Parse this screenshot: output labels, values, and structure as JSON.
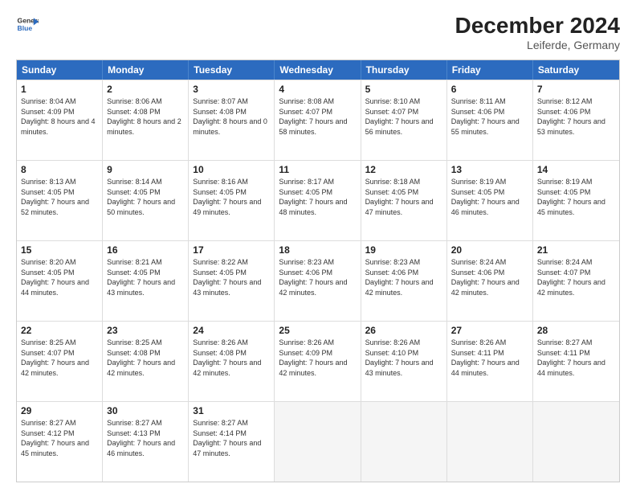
{
  "logo": {
    "line1": "General",
    "line2": "Blue",
    "arrow_color": "#2c6bbf"
  },
  "title": "December 2024",
  "subtitle": "Leiferde, Germany",
  "days_of_week": [
    "Sunday",
    "Monday",
    "Tuesday",
    "Wednesday",
    "Thursday",
    "Friday",
    "Saturday"
  ],
  "weeks": [
    [
      {
        "day": 1,
        "sunrise": "8:04 AM",
        "sunset": "4:09 PM",
        "daylight": "8 hours and 4 minutes."
      },
      {
        "day": 2,
        "sunrise": "8:06 AM",
        "sunset": "4:08 PM",
        "daylight": "8 hours and 2 minutes."
      },
      {
        "day": 3,
        "sunrise": "8:07 AM",
        "sunset": "4:08 PM",
        "daylight": "8 hours and 0 minutes."
      },
      {
        "day": 4,
        "sunrise": "8:08 AM",
        "sunset": "4:07 PM",
        "daylight": "7 hours and 58 minutes."
      },
      {
        "day": 5,
        "sunrise": "8:10 AM",
        "sunset": "4:07 PM",
        "daylight": "7 hours and 56 minutes."
      },
      {
        "day": 6,
        "sunrise": "8:11 AM",
        "sunset": "4:06 PM",
        "daylight": "7 hours and 55 minutes."
      },
      {
        "day": 7,
        "sunrise": "8:12 AM",
        "sunset": "4:06 PM",
        "daylight": "7 hours and 53 minutes."
      }
    ],
    [
      {
        "day": 8,
        "sunrise": "8:13 AM",
        "sunset": "4:05 PM",
        "daylight": "7 hours and 52 minutes."
      },
      {
        "day": 9,
        "sunrise": "8:14 AM",
        "sunset": "4:05 PM",
        "daylight": "7 hours and 50 minutes."
      },
      {
        "day": 10,
        "sunrise": "8:16 AM",
        "sunset": "4:05 PM",
        "daylight": "7 hours and 49 minutes."
      },
      {
        "day": 11,
        "sunrise": "8:17 AM",
        "sunset": "4:05 PM",
        "daylight": "7 hours and 48 minutes."
      },
      {
        "day": 12,
        "sunrise": "8:18 AM",
        "sunset": "4:05 PM",
        "daylight": "7 hours and 47 minutes."
      },
      {
        "day": 13,
        "sunrise": "8:19 AM",
        "sunset": "4:05 PM",
        "daylight": "7 hours and 46 minutes."
      },
      {
        "day": 14,
        "sunrise": "8:19 AM",
        "sunset": "4:05 PM",
        "daylight": "7 hours and 45 minutes."
      }
    ],
    [
      {
        "day": 15,
        "sunrise": "8:20 AM",
        "sunset": "4:05 PM",
        "daylight": "7 hours and 44 minutes."
      },
      {
        "day": 16,
        "sunrise": "8:21 AM",
        "sunset": "4:05 PM",
        "daylight": "7 hours and 43 minutes."
      },
      {
        "day": 17,
        "sunrise": "8:22 AM",
        "sunset": "4:05 PM",
        "daylight": "7 hours and 43 minutes."
      },
      {
        "day": 18,
        "sunrise": "8:23 AM",
        "sunset": "4:06 PM",
        "daylight": "7 hours and 42 minutes."
      },
      {
        "day": 19,
        "sunrise": "8:23 AM",
        "sunset": "4:06 PM",
        "daylight": "7 hours and 42 minutes."
      },
      {
        "day": 20,
        "sunrise": "8:24 AM",
        "sunset": "4:06 PM",
        "daylight": "7 hours and 42 minutes."
      },
      {
        "day": 21,
        "sunrise": "8:24 AM",
        "sunset": "4:07 PM",
        "daylight": "7 hours and 42 minutes."
      }
    ],
    [
      {
        "day": 22,
        "sunrise": "8:25 AM",
        "sunset": "4:07 PM",
        "daylight": "7 hours and 42 minutes."
      },
      {
        "day": 23,
        "sunrise": "8:25 AM",
        "sunset": "4:08 PM",
        "daylight": "7 hours and 42 minutes."
      },
      {
        "day": 24,
        "sunrise": "8:26 AM",
        "sunset": "4:08 PM",
        "daylight": "7 hours and 42 minutes."
      },
      {
        "day": 25,
        "sunrise": "8:26 AM",
        "sunset": "4:09 PM",
        "daylight": "7 hours and 42 minutes."
      },
      {
        "day": 26,
        "sunrise": "8:26 AM",
        "sunset": "4:10 PM",
        "daylight": "7 hours and 43 minutes."
      },
      {
        "day": 27,
        "sunrise": "8:26 AM",
        "sunset": "4:11 PM",
        "daylight": "7 hours and 44 minutes."
      },
      {
        "day": 28,
        "sunrise": "8:27 AM",
        "sunset": "4:11 PM",
        "daylight": "7 hours and 44 minutes."
      }
    ],
    [
      {
        "day": 29,
        "sunrise": "8:27 AM",
        "sunset": "4:12 PM",
        "daylight": "7 hours and 45 minutes."
      },
      {
        "day": 30,
        "sunrise": "8:27 AM",
        "sunset": "4:13 PM",
        "daylight": "7 hours and 46 minutes."
      },
      {
        "day": 31,
        "sunrise": "8:27 AM",
        "sunset": "4:14 PM",
        "daylight": "7 hours and 47 minutes."
      },
      null,
      null,
      null,
      null
    ]
  ]
}
